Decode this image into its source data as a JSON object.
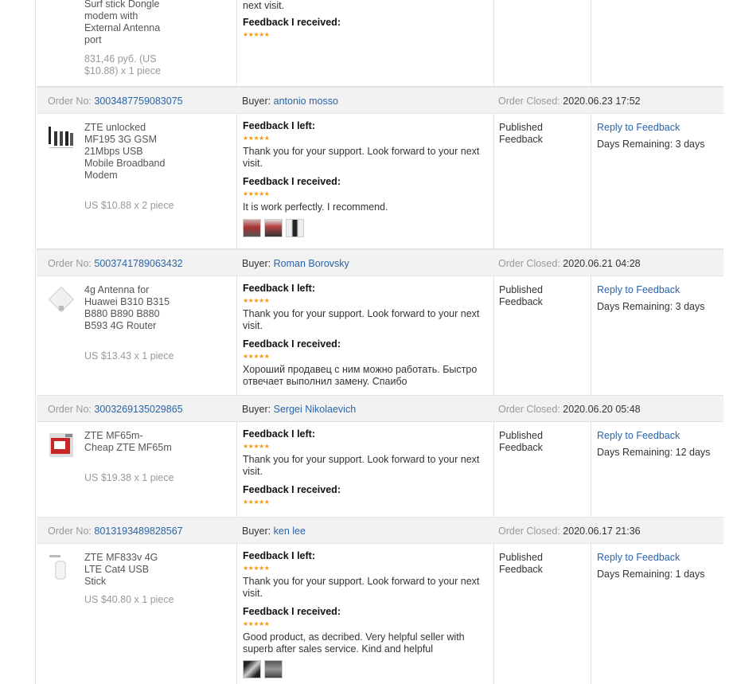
{
  "first_partial": {
    "product_name": "Surf stick Dongle modem with External Antenna port",
    "price": "831,46 руб. (US $10.88) x 1 piece",
    "next_visit": "next visit.",
    "received_title": "Feedback I received:",
    "stars": "★★★★★"
  },
  "labels": {
    "order_no": "Order No:",
    "buyer": "Buyer:",
    "order_closed": "Order Closed:",
    "feedback_left": "Feedback I left:",
    "feedback_received": "Feedback I received:",
    "status": "Published Feedback",
    "reply": "Reply to Feedback",
    "stars": "★★★★★",
    "left_text": "Thank you for your support. Look forward to your next visit."
  },
  "orders": [
    {
      "order_no": "3003487759083075",
      "buyer": "antonio mosso",
      "closed": "2020.06.23 17:52",
      "product_name": "ZTE unlocked MF195 3G GSM 21Mbps USB Mobile Broadband Modem",
      "price": "US $10.88 x 2 piece",
      "received_text": "It is work perfectly. I recommend.",
      "days": "Days Remaining: 3 days"
    },
    {
      "order_no": "5003741789063432",
      "buyer": "Roman Borovsky",
      "closed": "2020.06.21 04:28",
      "product_name": "4g Antenna for Huawei B310 B315 B880 B890 B880 B593 4G Router",
      "price": "US $13.43 x 1 piece",
      "received_text": "Хороший продавец с ним можно работать. Быстро отвечает выполнил замену. Спаибо",
      "days": "Days Remaining: 3 days"
    },
    {
      "order_no": "3003269135029865",
      "buyer": "Sergei Nikolaevich",
      "closed": "2020.06.20 05:48",
      "product_name": "ZTE MF65m- Cheap ZTE MF65m",
      "price": "US $19.38 x 1 piece",
      "received_text": "",
      "days": "Days Remaining: 12 days"
    },
    {
      "order_no": "8013193489828567",
      "buyer": "ken lee",
      "closed": "2020.06.17 21:36",
      "product_name": "ZTE MF833v 4G LTE Cat4 USB Stick",
      "price": "US $40.80 x 1 piece",
      "received_text": "Good product, as decribed. Very helpful seller with superb after sales service. Kind and helpful",
      "days": "Days Remaining: 1 days"
    }
  ]
}
